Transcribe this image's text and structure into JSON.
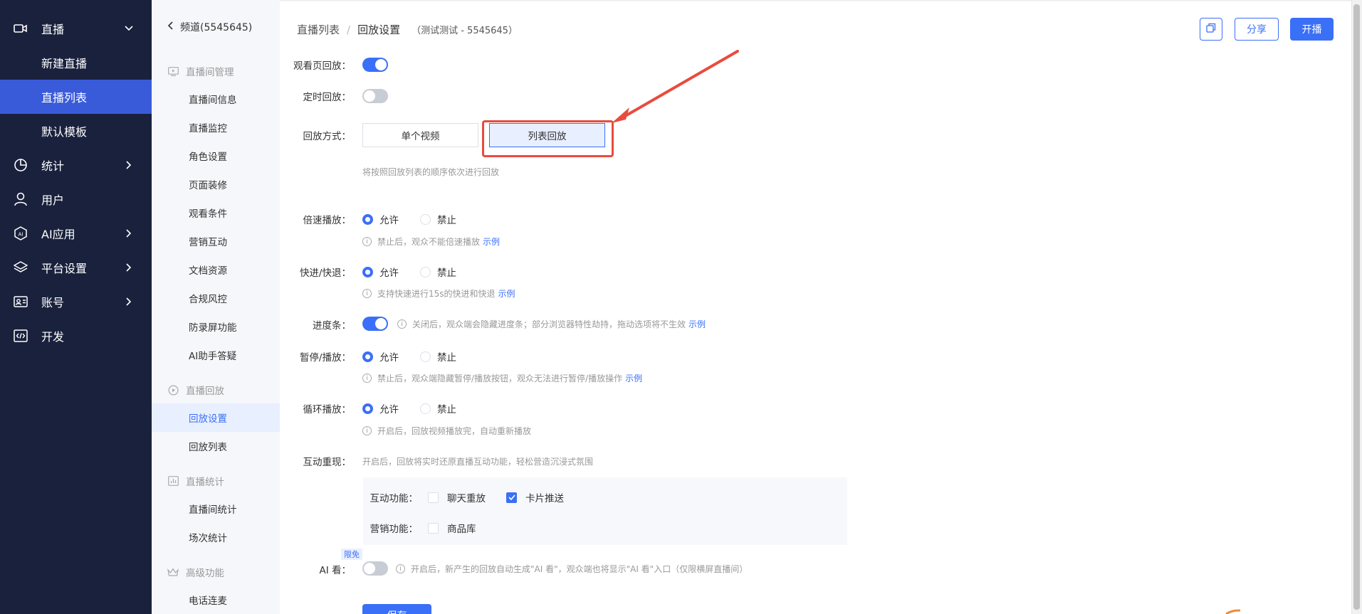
{
  "nav": {
    "live": "直播",
    "new_live": "新建直播",
    "live_list": "直播列表",
    "default_template": "默认模板",
    "stats": "统计",
    "users": "用户",
    "ai_apps": "AI应用",
    "platform_settings": "平台设置",
    "account": "账号",
    "develop": "开发"
  },
  "menu": {
    "back": "频道(5545645)",
    "group_room": "直播间管理",
    "room_info": "直播间信息",
    "monitor": "直播监控",
    "roles": "角色设置",
    "decoration": "页面装修",
    "conditions": "观看条件",
    "marketing": "营销互动",
    "docs": "文档资源",
    "compliance": "合规风控",
    "anti_record": "防录屏功能",
    "ai_assistant": "AI助手答疑",
    "group_replay": "直播回放",
    "replay_settings": "回放设置",
    "replay_list": "回放列表",
    "group_stats": "直播统计",
    "room_stats": "直播间统计",
    "session_stats": "场次统计",
    "group_advanced": "高级功能",
    "phone_mic": "电话连麦"
  },
  "header": {
    "crumb_list": "直播列表",
    "crumb_sep": "/",
    "crumb_current": "回放设置",
    "channel_suffix": "（测试测试 - 5545645）",
    "share": "分享",
    "start_live": "开播"
  },
  "form": {
    "watch_replay_label": "观看页回放：",
    "timed_replay_label": "定时回放：",
    "replay_mode_label": "回放方式：",
    "mode_single": "单个视频",
    "mode_list": "列表回放",
    "mode_hint": "将按照回放列表的顺序依次进行回放",
    "speed_label": "倍速播放：",
    "allow": "允许",
    "forbid": "禁止",
    "speed_hint": "禁止后，观众不能倍速播放",
    "example": "示例",
    "seek_label": "快进/快退：",
    "seek_hint": "支持快速进行15s的快进和快退",
    "progress_label": "进度条：",
    "progress_hint": "关闭后，观众端会隐藏进度条；部分浏览器特性劫持，拖动选项将不生效",
    "pause_label": "暂停/播放：",
    "pause_hint": "禁止后，观众端隐藏暂停/播放按钮，观众无法进行暂停/播放操作",
    "loop_label": "循环播放：",
    "loop_hint": "开启后，回放视频播放完，自动重新播放",
    "interact_label": "互动重现：",
    "interact_hint": "开启后，回放将实时还原直播互动功能，轻松营造沉浸式氛围",
    "interact_func_label": "互动功能：",
    "chat_replay": "聊天重放",
    "card_push": "卡片推送",
    "marketing_func_label": "营销功能：",
    "goods_lib": "商品库",
    "ai_badge": "限免",
    "ai_label": "AI 看：",
    "ai_hint": "开启后，新产生的回放自动生成\"AI 看\"，观众端也将显示\"AI 看\"入口（仅限横屏直播间）",
    "save": "保存"
  },
  "colors": {
    "nav_bg": "#19213d",
    "accent": "#3a6ff7",
    "highlight": "#e84c3d"
  }
}
